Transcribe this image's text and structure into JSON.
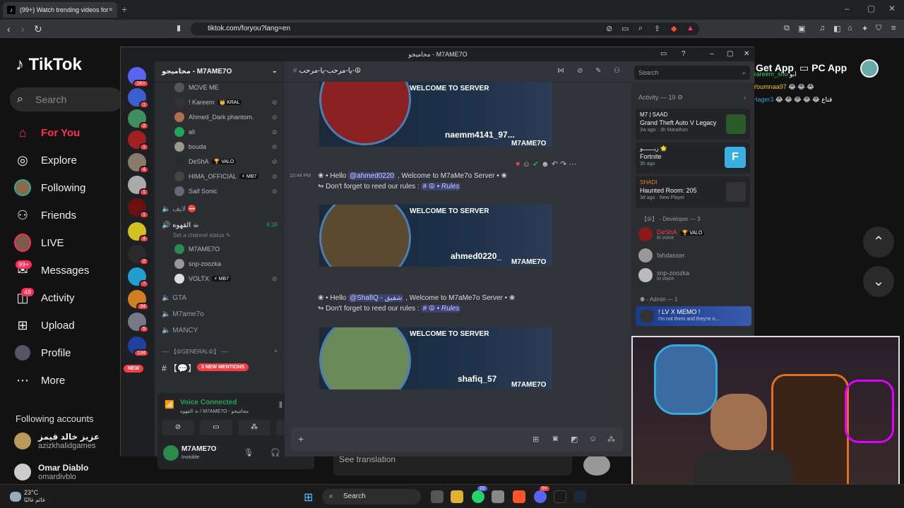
{
  "browser": {
    "tab_title": "(99+) Watch trending videos for",
    "url": "tiktok.com/foryou?lang=en"
  },
  "tiktok": {
    "logo": "TikTok",
    "search_placeholder": "Search",
    "nav": [
      {
        "label": "For You",
        "icon": "home-icon",
        "active": true
      },
      {
        "label": "Explore",
        "icon": "compass-icon"
      },
      {
        "label": "Following",
        "icon": "following-avatar"
      },
      {
        "label": "Friends",
        "icon": "friends-icon"
      },
      {
        "label": "LIVE",
        "icon": "live-avatar"
      },
      {
        "label": "Messages",
        "icon": "messages-icon",
        "badge": "99+"
      },
      {
        "label": "Activity",
        "icon": "activity-icon",
        "badge": "48"
      },
      {
        "label": "Upload",
        "icon": "upload-icon"
      },
      {
        "label": "Profile",
        "icon": "profile-avatar"
      },
      {
        "label": "More",
        "icon": "more-icon"
      }
    ],
    "following_header": "Following accounts",
    "following": [
      {
        "display": "عزيز خالد قيمز",
        "handle": "azizkhalidgames"
      },
      {
        "display": "Omar Diablo",
        "handle": "omardivblo"
      }
    ],
    "get_app": "Get App",
    "pc_app": "PC App",
    "see_translation": "See translation",
    "live_chat": [
      {
        "user": "kareem_shu",
        "text": "ابو"
      },
      {
        "user": "Youmnaa97",
        "text": "😂 😂 😂"
      },
      {
        "user": "Hager3",
        "text": "😂 😂 😂 😂 😂 قناع"
      }
    ]
  },
  "discord": {
    "window_title": "محاميجو - M7AME7O",
    "server_name": "محاميجو - M7AME7O",
    "channel_header": "يا-مرحب-يا-مرحب-☮",
    "search_placeholder": "Search",
    "server_badges": [
      "1K+",
      "1",
      "3",
      "1",
      "4",
      "1",
      "1",
      "4",
      "2",
      "7",
      "34",
      "5",
      "134"
    ],
    "voice_users_top": [
      {
        "name": "MOVE ME",
        "tag": ""
      },
      {
        "name": "! Kareem",
        "tag": "👑 KRAL"
      },
      {
        "name": "Ahmed_Dark phantom.",
        "tag": ""
      },
      {
        "name": "ali",
        "tag": ""
      },
      {
        "name": "bouda",
        "tag": ""
      },
      {
        "name": "DeShA",
        "tag": "🏆 VALO"
      },
      {
        "name": "HIMA_OFFICIAL",
        "tag": "⚡ MB7"
      },
      {
        "name": "Saif Sonic",
        "tag": ""
      }
    ],
    "voice_channel_1": "لايف ⛔",
    "voice_channel_2": "القهوه ☕",
    "voice_channel_2_time": "6:38",
    "channel_status": "Set a channel status",
    "voice_users_bottom": [
      {
        "name": "M7AME7O",
        "tag": ""
      },
      {
        "name": "snp-zoozka",
        "tag": ""
      },
      {
        "name": "VOLTX",
        "tag": "⚡ MB7"
      }
    ],
    "other_channels": [
      "GTA",
      "M7ame7o",
      "MANCY"
    ],
    "general_category": "---- 【☮GENERAL☮】 ----",
    "new_badge": "NEW",
    "new_mentions": "3 NEW MENTIONS",
    "voice_connected": "Voice Connected",
    "voice_location": "القهوه ☕ / M7AME7O - محاميجو",
    "user_name": "M7AME7O",
    "user_status": "Invisible",
    "messages": [
      {
        "banner_user": "naemm4141_97...",
        "time": "",
        "mention": "",
        "line2": ""
      },
      {
        "banner_user": "ahmed0220_",
        "time": "10:44 PM",
        "mention": "@ahmed0220",
        "greeting_pre": "❀ • Hello ",
        "greeting_post": " , Welcome to M7aMe7o Server • ❀",
        "line2_pre": "↬ Don't forget to reed our rules : ",
        "rules": "# ☮ • Rules"
      },
      {
        "banner_user": "shafiq_57",
        "time": "",
        "mention": "@ShafiQ - شفيق",
        "greeting_pre": "❀ • Hello ",
        "greeting_post": " , Welcome to M7aMe7o Server • ❀",
        "line2_pre": "↬ Don't forget to reed our rules : ",
        "rules": "# ☮ • Rules"
      }
    ],
    "banner_welcome": "WELCOME TO SERVER",
    "banner_brand": "M7AME7O",
    "activity_header": "Activity — 19",
    "activities": [
      {
        "who": "M7 | SAAD",
        "game": "Grand Theft Auto V Legacy",
        "meta": "2w ago · 3h Marathon"
      },
      {
        "who": "زيـــــــو 🌟",
        "game": "Fortnite",
        "meta": "3h ago"
      },
      {
        "who": "SHADI",
        "game": "Haunted Room: 205",
        "meta": "3d ago · New Player"
      }
    ],
    "developer_header": "【☮】 - Developer — 3",
    "developers": [
      {
        "name": "DeShA",
        "tag": "🏆 VALO",
        "status": "In voice"
      },
      {
        "name": "fahdasser",
        "tag": "",
        "status": ""
      },
      {
        "name": "snp-zoozka",
        "tag": "",
        "status": "In voice"
      }
    ],
    "admin_header": "Admin — 1",
    "admin": {
      "name": "! LV X MEMO !",
      "status": "I'm not them and they're n..."
    }
  },
  "taskbar": {
    "temp": "23°C",
    "weather_text": "غائم غالبًا",
    "search": "Search",
    "badges": [
      "22",
      "9+"
    ]
  },
  "colors": {
    "tiktok_red": "#fe2c55",
    "discord_bg": "#313338",
    "discord_blurple": "#5865f2",
    "voice_green": "#23a559"
  }
}
